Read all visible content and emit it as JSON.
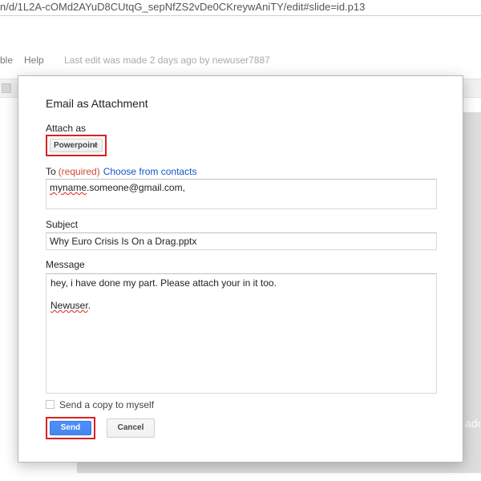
{
  "browser": {
    "url": "n/d/1L2A-cOMd2AYuD8CUtqG_sepNfZS2vDe0CKreywAniTY/edit#slide=id.p13"
  },
  "docs_menu": {
    "items": [
      "ble",
      "Help"
    ],
    "last_edit": "Last edit was made 2 days ago by newuser7887"
  },
  "background": {
    "slide_text": "ado"
  },
  "dialog": {
    "title": "Email as Attachment",
    "attach_as_label": "Attach as",
    "attach_as_value": "Powerpoint",
    "to_label": "To",
    "to_required": "(required)",
    "choose_contacts": "Choose from contacts",
    "to_value_prefix": "myname",
    "to_value_rest": ".someone@gmail.com,",
    "subject_label": "Subject",
    "subject_value": "Why Euro Crisis Is On a Drag.pptx",
    "message_label": "Message",
    "message_line1": "hey, i have done my part. Please attach your in it too.",
    "message_line2_name": "Newuser",
    "message_line2_rest": ".",
    "send_copy_label": "Send a copy to myself",
    "send_copy_checked": false,
    "send_label": "Send",
    "cancel_label": "Cancel"
  },
  "colors": {
    "highlight": "#d92121",
    "primary_button": "#4d90fe",
    "link": "#1155cc",
    "required": "#d14836"
  }
}
